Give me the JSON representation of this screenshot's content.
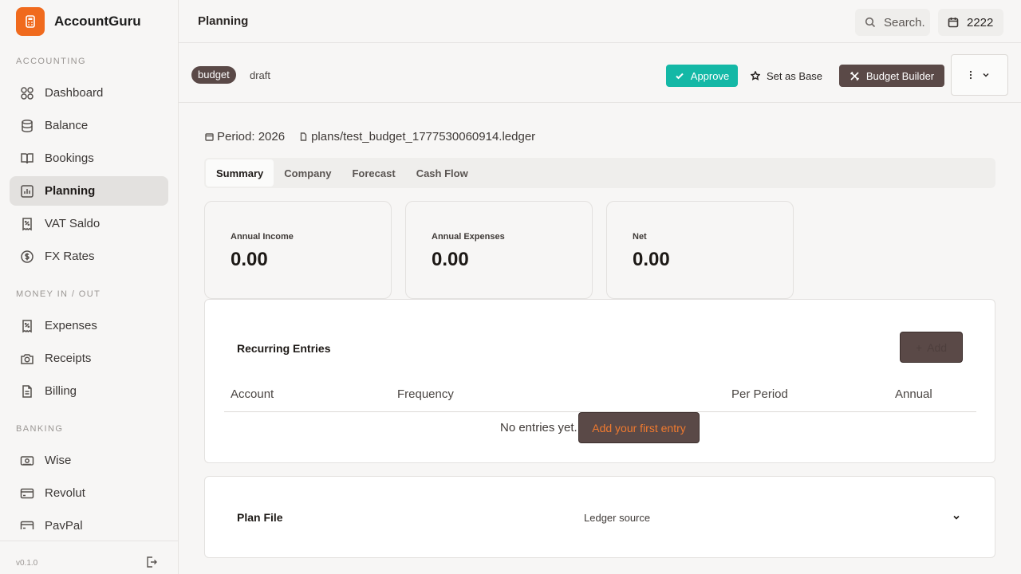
{
  "app": {
    "name": "AccountGuru",
    "version": "v0.1.0"
  },
  "sidebar": {
    "sections": [
      {
        "label": "ACCOUNTING",
        "items": [
          {
            "label": "Dashboard",
            "icon": "grid-icon"
          },
          {
            "label": "Balance",
            "icon": "database-icon"
          },
          {
            "label": "Bookings",
            "icon": "book-icon"
          },
          {
            "label": "Planning",
            "icon": "chart-icon",
            "active": true
          },
          {
            "label": "VAT Saldo",
            "icon": "receipt-percent-icon"
          },
          {
            "label": "FX Rates",
            "icon": "dollar-circle-icon"
          }
        ]
      },
      {
        "label": "MONEY IN / OUT",
        "items": [
          {
            "label": "Expenses",
            "icon": "receipt-percent-icon"
          },
          {
            "label": "Receipts",
            "icon": "camera-icon"
          },
          {
            "label": "Billing",
            "icon": "file-text-icon"
          }
        ]
      },
      {
        "label": "BANKING",
        "items": [
          {
            "label": "Wise",
            "icon": "banknote-icon"
          },
          {
            "label": "Revolut",
            "icon": "credit-card-icon"
          },
          {
            "label": "PayPal",
            "icon": "credit-card-icon"
          }
        ]
      }
    ]
  },
  "topbar": {
    "title": "Planning",
    "search_label": "Search.",
    "year": "2222"
  },
  "actionbar": {
    "badge": "budget",
    "status": "draft",
    "approve_label": "Approve",
    "set_base_label": "Set as Base",
    "builder_label": "Budget Builder"
  },
  "meta": {
    "period": "Period: 2026",
    "file": "plans/test_budget_1777530060914.ledger"
  },
  "tabs": [
    "Summary",
    "Company",
    "Forecast",
    "Cash Flow"
  ],
  "stats": [
    {
      "label": "Annual Income",
      "value": "0.00"
    },
    {
      "label": "Annual Expenses",
      "value": "0.00"
    },
    {
      "label": "Net",
      "value": "0.00"
    }
  ],
  "recurring": {
    "title": "Recurring Entries",
    "add_label": "Add",
    "columns": [
      "Account",
      "Frequency",
      "Per Period",
      "Annual"
    ],
    "empty_text": "No entries yet.",
    "first_entry_label": "Add your first entry"
  },
  "plan_file": {
    "title": "Plan File",
    "source_label": "Ledger source"
  },
  "colors": {
    "accent": "#f06a1d",
    "teal": "#14b8a6",
    "brown": "#5a4947"
  }
}
